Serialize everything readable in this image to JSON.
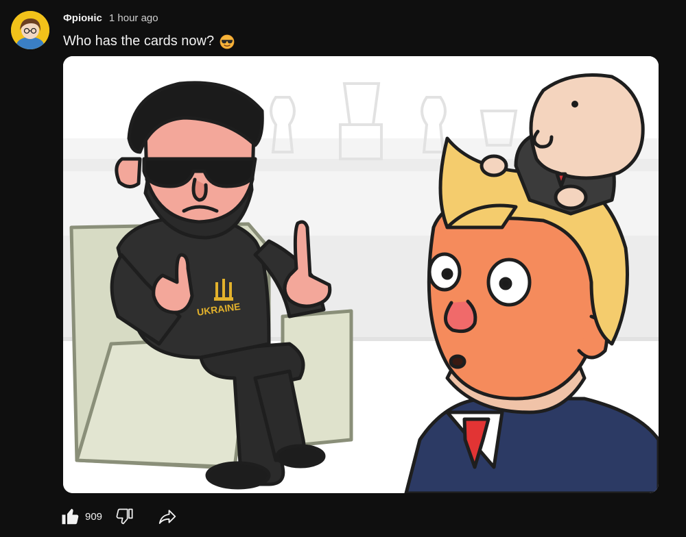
{
  "comment": {
    "author": "Фріоніс",
    "time": "1 hour ago",
    "text": "Who has the cards now?",
    "emoji": "smiling-face-with-sunglasses",
    "image": {
      "shirt_text": "UKRAINE"
    }
  },
  "actions": {
    "like_count": "909",
    "like_icon": "thumbs-up-icon",
    "dislike_icon": "thumbs-down-icon",
    "share_icon": "share-arrow-icon"
  },
  "colors": {
    "background": "#0f0f0f",
    "text": "#f1f1f1",
    "secondary_text": "#cfcfcf"
  }
}
